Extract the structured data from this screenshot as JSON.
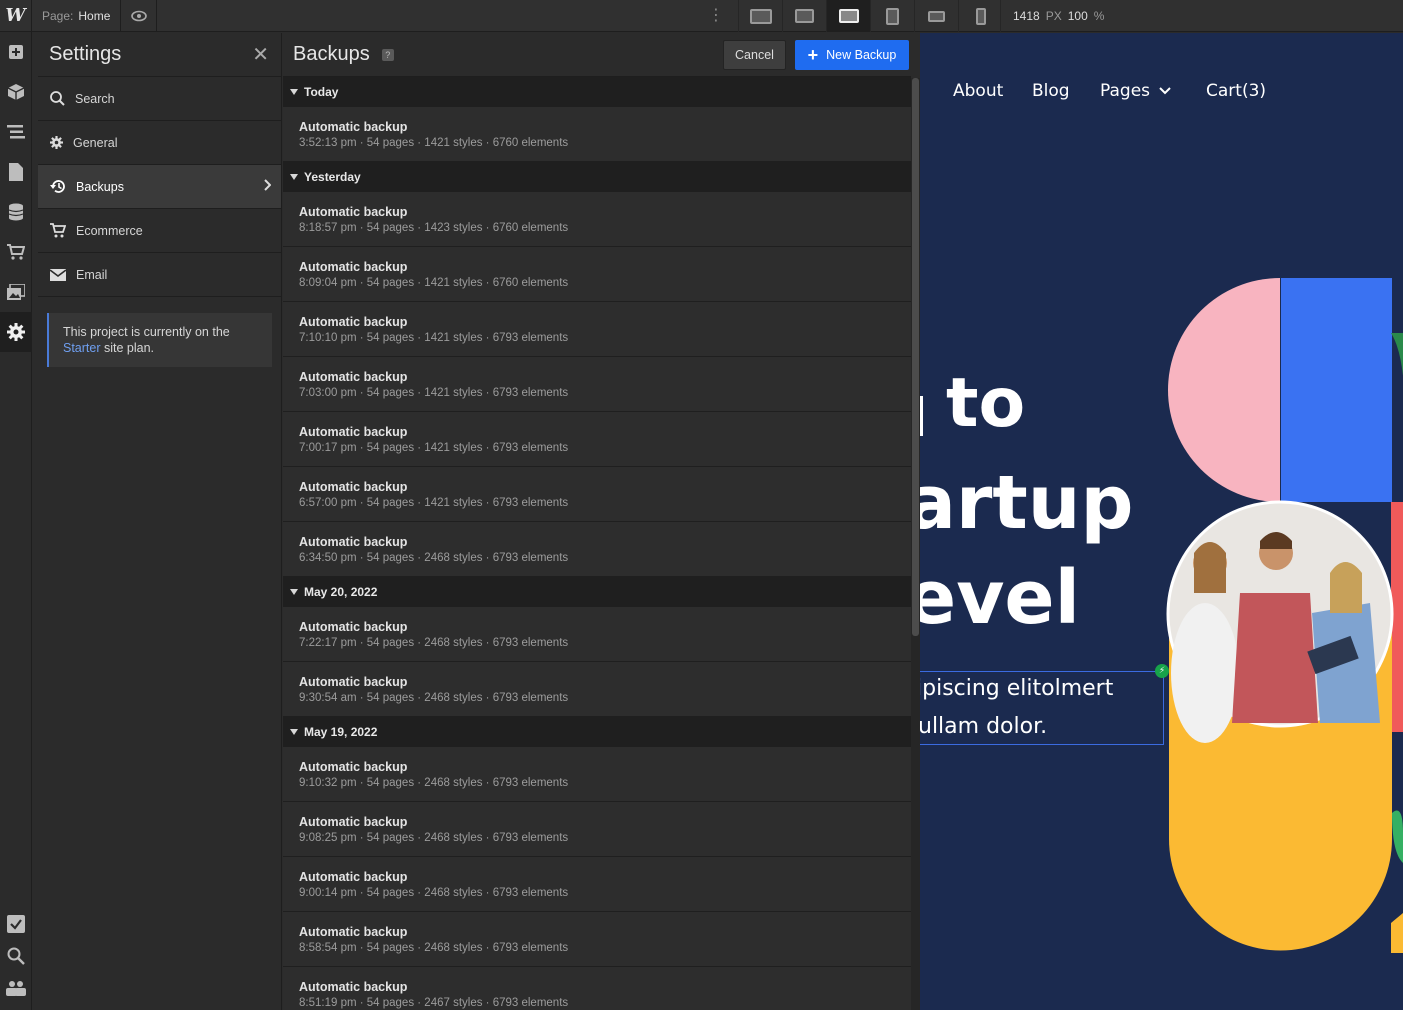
{
  "topbar": {
    "logo": "W",
    "page_key": "Page:",
    "page_value": "Home",
    "viewport_width": "1418",
    "width_unit": "PX",
    "zoom": "100",
    "zoom_unit": "%"
  },
  "settings": {
    "title": "Settings",
    "items": [
      {
        "label": "Search",
        "icon": "search-icon"
      },
      {
        "label": "General",
        "icon": "gear-icon"
      },
      {
        "label": "Backups",
        "icon": "history-icon"
      },
      {
        "label": "Ecommerce",
        "icon": "cart-icon"
      },
      {
        "label": "Email",
        "icon": "envelope-icon"
      }
    ],
    "plan_text_1": "This project is currently on the",
    "plan_link": "Starter",
    "plan_text_2": "site plan."
  },
  "backups": {
    "title": "Backups",
    "help": "?",
    "cancel_label": "Cancel",
    "new_label": "New Backup",
    "groups": [
      {
        "label": "Today",
        "entries": [
          {
            "title": "Automatic backup",
            "meta": "3:52:13 pm · 54 pages · 1421 styles · 6760 elements"
          }
        ]
      },
      {
        "label": "Yesterday",
        "entries": [
          {
            "title": "Automatic backup",
            "meta": "8:18:57 pm · 54 pages · 1423 styles · 6760 elements"
          },
          {
            "title": "Automatic backup",
            "meta": "8:09:04 pm · 54 pages · 1421 styles · 6760 elements"
          },
          {
            "title": "Automatic backup",
            "meta": "7:10:10 pm · 54 pages · 1421 styles · 6793 elements"
          },
          {
            "title": "Automatic backup",
            "meta": "7:03:00 pm · 54 pages · 1421 styles · 6793 elements"
          },
          {
            "title": "Automatic backup",
            "meta": "7:00:17 pm · 54 pages · 1421 styles · 6793 elements"
          },
          {
            "title": "Automatic backup",
            "meta": "6:57:00 pm · 54 pages · 1421 styles · 6793 elements"
          },
          {
            "title": "Automatic backup",
            "meta": "6:34:50 pm · 54 pages · 2468 styles · 6793 elements"
          }
        ]
      },
      {
        "label": "May 20, 2022",
        "entries": [
          {
            "title": "Automatic backup",
            "meta": "7:22:17 pm · 54 pages · 2468 styles · 6793 elements"
          },
          {
            "title": "Automatic backup",
            "meta": "9:30:54 am · 54 pages · 2468 styles · 6793 elements"
          }
        ]
      },
      {
        "label": "May 19, 2022",
        "entries": [
          {
            "title": "Automatic backup",
            "meta": "9:10:32 pm · 54 pages · 2468 styles · 6793 elements"
          },
          {
            "title": "Automatic backup",
            "meta": "9:08:25 pm · 54 pages · 2468 styles · 6793 elements"
          },
          {
            "title": "Automatic backup",
            "meta": "9:00:14 pm · 54 pages · 2468 styles · 6793 elements"
          },
          {
            "title": "Automatic backup",
            "meta": "8:58:54 pm · 54 pages · 2468 styles · 6793 elements"
          },
          {
            "title": "Automatic backup",
            "meta": "8:51:19 pm · 54 pages · 2467 styles · 6793 elements"
          }
        ]
      }
    ]
  },
  "canvas": {
    "nav": [
      "About",
      "Blog",
      "Pages",
      "Cart(3)"
    ],
    "hero_line_1": "to",
    "hero_line_2": "artup",
    "hero_line_3": "evel",
    "sub_line_1": "ipiscing elitolmert",
    "sub_line_2": "ullam dolor.",
    "colors": {
      "bg": "#1b2a4f",
      "pink": "#f8b4c0",
      "blue": "#3a72f2",
      "yellow": "#fbba33",
      "accent": "#1f6cf0"
    }
  }
}
